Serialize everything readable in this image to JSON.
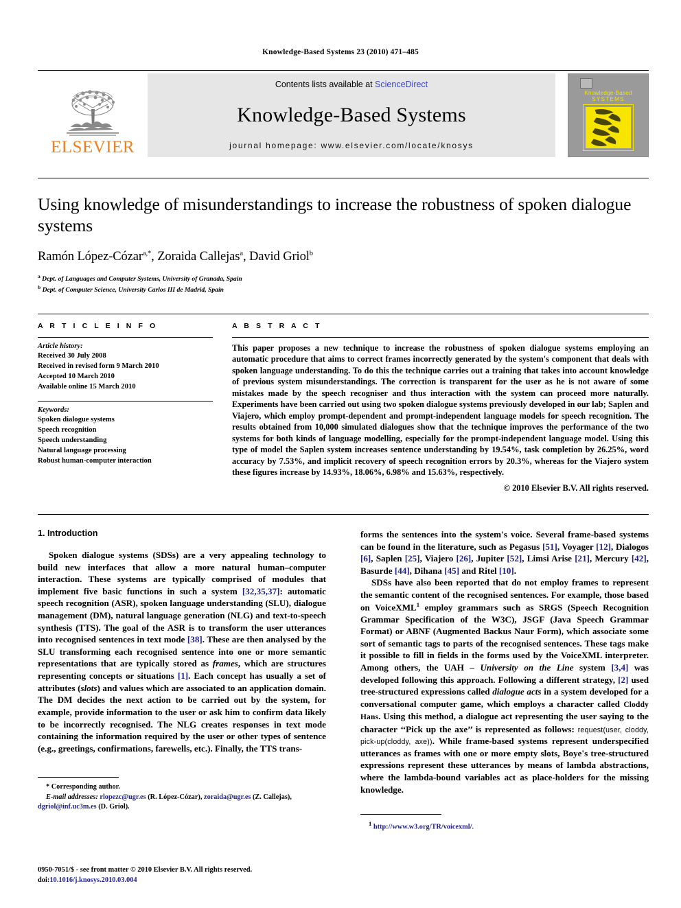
{
  "running_head": "Knowledge-Based Systems 23 (2010) 471–485",
  "masthead": {
    "publisher_wordmark": "ELSEVIER",
    "contents_prefix": "Contents lists available at ",
    "contents_link": "ScienceDirect",
    "journal_name": "Knowledge-Based Systems",
    "homepage": "journal homepage: www.elsevier.com/locate/knosys",
    "cover": {
      "title_line1": "Knowledge-Based",
      "title_line2": "SYSTEMS"
    }
  },
  "article": {
    "title": "Using knowledge of misunderstandings to increase the robustness of spoken dialogue systems",
    "authors": "Ramón López-Cózar",
    "authors_full": [
      {
        "name": "Ramón López-Cózar",
        "marks": "a,*"
      },
      {
        "name": "Zoraida Callejas",
        "marks": "a"
      },
      {
        "name": "David Griol",
        "marks": "b"
      }
    ],
    "affiliations": [
      {
        "mark": "a",
        "text": "Dept. of Languages and Computer Systems, University of Granada, Spain"
      },
      {
        "mark": "b",
        "text": "Dept. of Computer Science, University Carlos III de Madrid, Spain"
      }
    ]
  },
  "article_info": {
    "heading": "A R T I C L E  I N F O",
    "history_label": "Article history:",
    "history": [
      "Received 30 July 2008",
      "Received in revised form 9 March 2010",
      "Accepted 10 March 2010",
      "Available online 15 March 2010"
    ],
    "keywords_label": "Keywords:",
    "keywords": [
      "Spoken dialogue systems",
      "Speech recognition",
      "Speech understanding",
      "Natural language processing",
      "Robust human-computer interaction"
    ]
  },
  "abstract": {
    "heading": "A B S T R A C T",
    "text": "This paper proposes a new technique to increase the robustness of spoken dialogue systems employing an automatic procedure that aims to correct frames incorrectly generated by the system's component that deals with spoken language understanding. To do this the technique carries out a training that takes into account knowledge of previous system misunderstandings. The correction is transparent for the user as he is not aware of some mistakes made by the speech recogniser and thus interaction with the system can proceed more naturally. Experiments have been carried out using two spoken dialogue systems previously developed in our lab; Saplen and Viajero, which employ prompt-dependent and prompt-independent language models for speech recognition. The results obtained from 10,000 simulated dialogues show that the technique improves the performance of the two systems for both kinds of language modelling, especially for the prompt-independent language model. Using this type of model the Saplen system increases sentence understanding by 19.54%, task completion by 26.25%, word accuracy by 7.53%, and implicit recovery of speech recognition errors by 20.3%, whereas for the Viajero system these figures increase by 14.93%, 18.06%, 6.98% and 15.63%, respectively.",
    "copyright": "© 2010 Elsevier B.V. All rights reserved."
  },
  "body": {
    "section_title": "1. Introduction",
    "left_p1_parts": {
      "a": "Spoken dialogue systems (SDSs) are a very appealing technology to build new interfaces that allow a more natural human–computer interaction. These systems are typically comprised of modules that implement five basic functions in such a system ",
      "r1": "[32,35,37]",
      "b": ": automatic speech recognition (ASR), spoken language understanding (SLU), dialogue management (DM), natural language generation (NLG) and text-to-speech synthesis (TTS). The goal of the ASR is to transform the user utterances into recognised sentences in text mode ",
      "r2": "[38]",
      "c": ". These are then analysed by the SLU transforming each recognised sentence into one or more semantic representations that are typically stored as ",
      "i1": "frames",
      "d": ", which are structures representing concepts or situations ",
      "r3": "[1]",
      "e": ". Each concept has usually a set of attributes (",
      "i2": "slots",
      "f": ") and values which are associated to an application domain. The DM decides the next action to be carried out by the system, for example, provide information to the user or ask him to confirm data likely to be incorrectly recognised. The NLG creates responses in text mode containing the information required by the user or other types of sentence (e.g., greetings, confirmations, farewells, etc.). Finally, the TTS trans-"
    },
    "right_p1_parts": {
      "a": "forms the sentences into the system's voice. Several frame-based systems can be found in the literature, such as Pegasus ",
      "r1": "[51]",
      "b": ", Voyager ",
      "r2": "[12]",
      "c": ", Dialogos ",
      "r3": "[6]",
      "d": ", Saplen ",
      "r4": "[25]",
      "e": ", Viajero ",
      "r5": "[26]",
      "f": ", Jupiter ",
      "r6": "[52]",
      "g": ", Limsi Arise ",
      "r7": "[21]",
      "h": ", Mercury ",
      "r8": "[42]",
      "i": ", Basurde ",
      "r9": "[44]",
      "j": ", Dihana ",
      "r10": "[45]",
      "k": " and Ritel ",
      "r11": "[10]",
      "l": "."
    },
    "right_p2_parts": {
      "a": "SDSs have also been reported that do not employ frames to represent the semantic content of the recognised sentences. For example, those based on VoiceXML",
      "fn": "1",
      "b": " employ grammars such as SRGS (Speech Recognition Grammar Specification of the W3C), JSGF (Java Speech Grammar Format) or ABNF (Augmented Backus Naur Form), which associate some sort of semantic tags to parts of the recognised sentences. These tags make it possible to fill in fields in the forms used by the VoiceXML interpreter. Among others, the UAH – ",
      "i1": "University on the Line",
      "c": " system ",
      "r1": "[3,4]",
      "d": " was developed following this approach. Following a different strategy, ",
      "r2": "[2]",
      "e": " used tree-structured expressions called ",
      "i2": "dialogue acts",
      "f": " in a system developed for a conversational computer game, which employs a character called ",
      "sc1": "Cloddy Hans",
      "g": ". Using this method, a dialogue act representing the user saying to the character ‘‘Pick up the axe’’ is represented as follows: ",
      "code": "request(user, cloddy, pick-up(cloddy, axe))",
      "h": ". While frame-based systems represent underspecified utterances as frames with one or more empty slots, Boye's tree-structured expressions represent these utterances by means of lambda abstractions, where the lambda-bound variables act as place-holders for the missing knowledge."
    }
  },
  "footnotes": {
    "corresponding_marker": "*",
    "corresponding_text": "Corresponding author.",
    "email_label": "E-mail addresses:",
    "emails": [
      {
        "address": "rlopezc@ugr.es",
        "owner": "(R. López-Cózar)"
      },
      {
        "address": "zoraida@ugr.es",
        "owner": "(Z. Callejas)"
      },
      {
        "address": "dgriol@inf.uc3m.es",
        "owner": "(D. Griol)"
      }
    ],
    "right_marker": "1",
    "right_url": "http://www.w3.org/TR/voicexml/."
  },
  "page_footer": {
    "issn_line": "0950-7051/$ - see front matter © 2010 Elsevier B.V. All rights reserved.",
    "doi_label": "doi:",
    "doi_value": "10.1016/j.knosys.2010.03.004"
  },
  "colors": {
    "elsevier_orange": "#f08020",
    "link_blue": "#3b43c8",
    "ref_blue": "#1f1f8c",
    "masthead_grey": "#e6e6e6",
    "cover_grey": "#9a9a9a",
    "cover_yellow": "#f7e500"
  }
}
